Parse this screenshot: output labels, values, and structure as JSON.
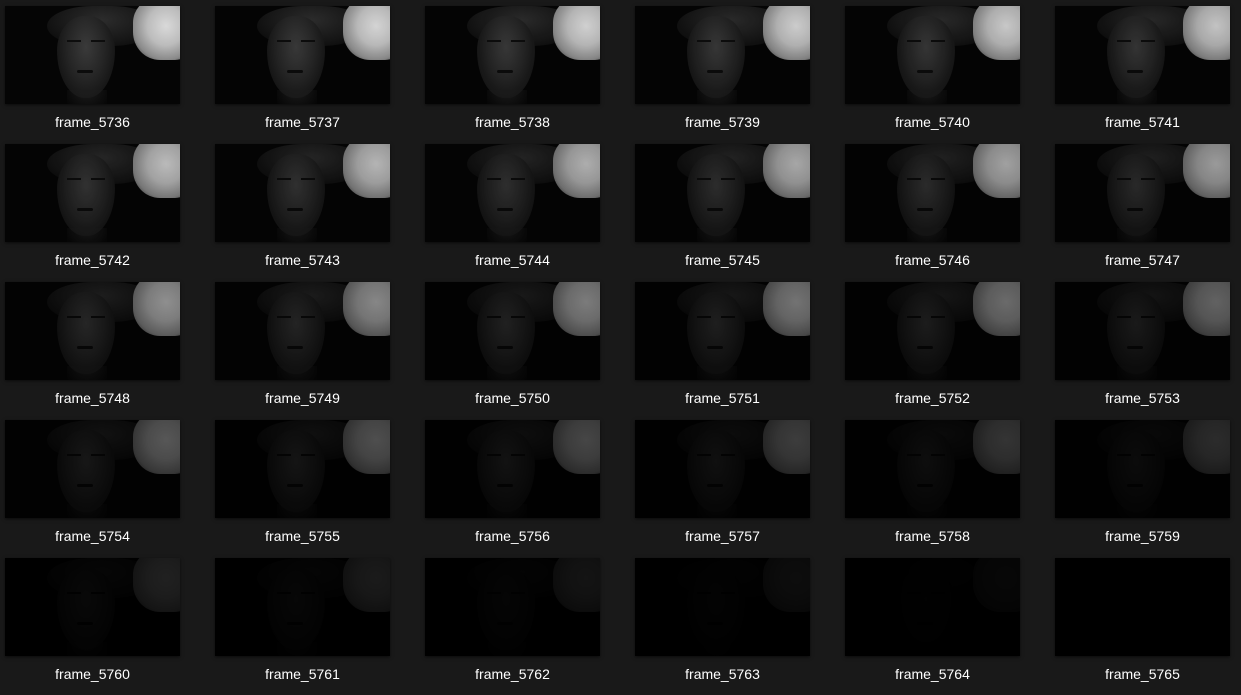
{
  "explorer": {
    "view": "large-icons",
    "background_color": "#191919",
    "label_color": "#ffffff",
    "files": [
      {
        "name": "frame_5736",
        "brightness": 1.0
      },
      {
        "name": "frame_5737",
        "brightness": 0.98
      },
      {
        "name": "frame_5738",
        "brightness": 0.96
      },
      {
        "name": "frame_5739",
        "brightness": 0.94
      },
      {
        "name": "frame_5740",
        "brightness": 0.92
      },
      {
        "name": "frame_5741",
        "brightness": 0.9
      },
      {
        "name": "frame_5742",
        "brightness": 0.86
      },
      {
        "name": "frame_5743",
        "brightness": 0.83
      },
      {
        "name": "frame_5744",
        "brightness": 0.8
      },
      {
        "name": "frame_5745",
        "brightness": 0.77
      },
      {
        "name": "frame_5746",
        "brightness": 0.74
      },
      {
        "name": "frame_5747",
        "brightness": 0.71
      },
      {
        "name": "frame_5748",
        "brightness": 0.66
      },
      {
        "name": "frame_5749",
        "brightness": 0.62
      },
      {
        "name": "frame_5750",
        "brightness": 0.57
      },
      {
        "name": "frame_5751",
        "brightness": 0.53
      },
      {
        "name": "frame_5752",
        "brightness": 0.49
      },
      {
        "name": "frame_5753",
        "brightness": 0.45
      },
      {
        "name": "frame_5754",
        "brightness": 0.4
      },
      {
        "name": "frame_5755",
        "brightness": 0.36
      },
      {
        "name": "frame_5756",
        "brightness": 0.32
      },
      {
        "name": "frame_5757",
        "brightness": 0.28
      },
      {
        "name": "frame_5758",
        "brightness": 0.24
      },
      {
        "name": "frame_5759",
        "brightness": 0.2
      },
      {
        "name": "frame_5760",
        "brightness": 0.15
      },
      {
        "name": "frame_5761",
        "brightness": 0.12
      },
      {
        "name": "frame_5762",
        "brightness": 0.09
      },
      {
        "name": "frame_5763",
        "brightness": 0.06
      },
      {
        "name": "frame_5764",
        "brightness": 0.03
      },
      {
        "name": "frame_5765",
        "brightness": 0.0
      }
    ]
  }
}
